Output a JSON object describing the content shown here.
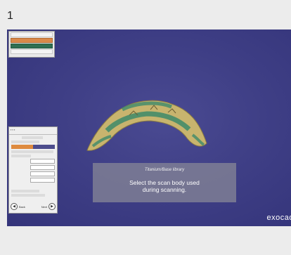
{
  "step_number": "1",
  "dialog": {
    "library": "Titanium/Base library",
    "message_line1": "Select the scan body used",
    "message_line2": "during scanning."
  },
  "brand": "exocad",
  "left_panel": {
    "back_label": "Back",
    "next_label": "Next"
  },
  "colors": {
    "viewport_bg": "#3f3f86",
    "accent_orange": "#de8a3e",
    "model_green": "#3d8a6a",
    "model_tan": "#c8b46e"
  },
  "icons": [
    "back-arrow-icon",
    "next-arrow-icon"
  ]
}
